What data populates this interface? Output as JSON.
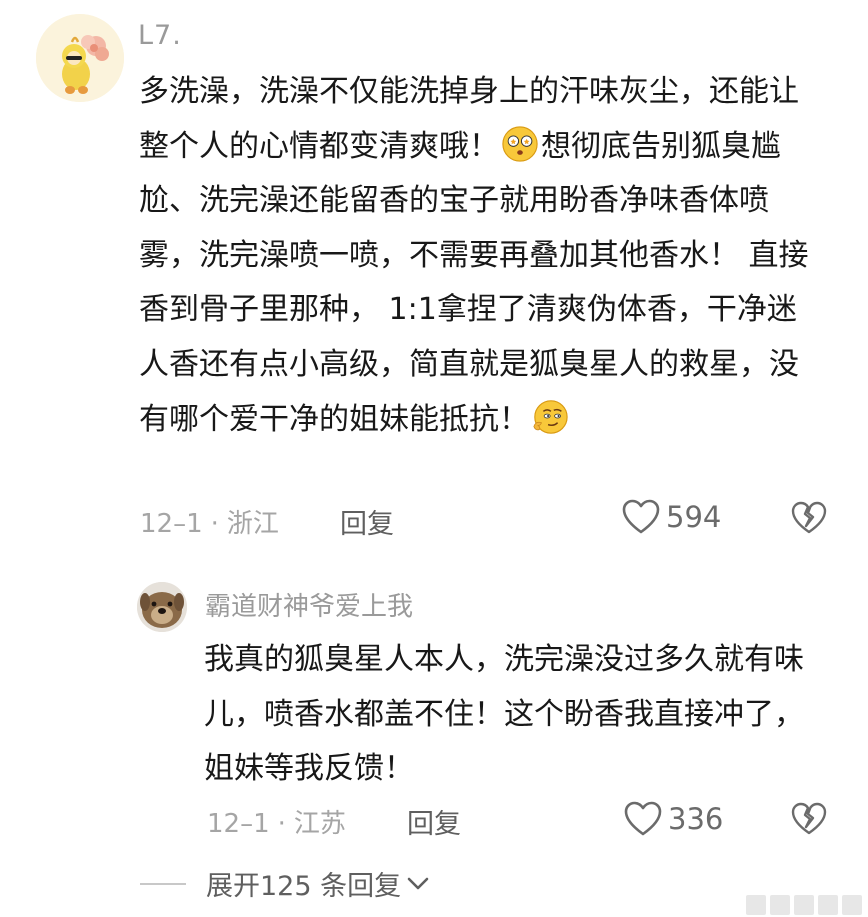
{
  "comment": {
    "username": "L7.",
    "text_part1": "多洗澡，洗澡不仅能洗掉身上的汗味灰尘，还能让整个人的心情都变清爽哦！",
    "emoji1": "heart-eyes-emoji",
    "text_part2": "想彻底告别狐臭尴尬、洗完澡还能留香的宝子就用盼香净味香体喷雾，洗完澡喷一喷，不需要再叠加其他香水！ 直接香到骨子里那种， 1:1拿捏了清爽伪体香，干净迷人香还有点小高级，简直就是狐臭星人的救星，没有哪个爱干净的姐妹能抵抗！",
    "emoji2": "smirk-emoji",
    "date": "12–1",
    "dot": "·",
    "location": "浙江",
    "reply_label": "回复",
    "likes": "594"
  },
  "reply": {
    "username": "霸道财神爷爱上我",
    "text": "我真的狐臭星人本人，洗完澡没过多久就有味儿，喷香水都盖不住！这个盼香我直接冲了，姐妹等我反馈！",
    "date": "12–1",
    "dot": "·",
    "location": "江苏",
    "reply_label": "回复",
    "likes": "336"
  },
  "expand": {
    "label": "展开125 条回复"
  },
  "icons": {
    "like": "heart-outline-icon",
    "dislike": "broken-heart-icon",
    "expand": "chevron-down-icon"
  },
  "colors": {
    "text": "#181818",
    "muted": "#a5a5a5",
    "action": "#5f5f5f"
  }
}
